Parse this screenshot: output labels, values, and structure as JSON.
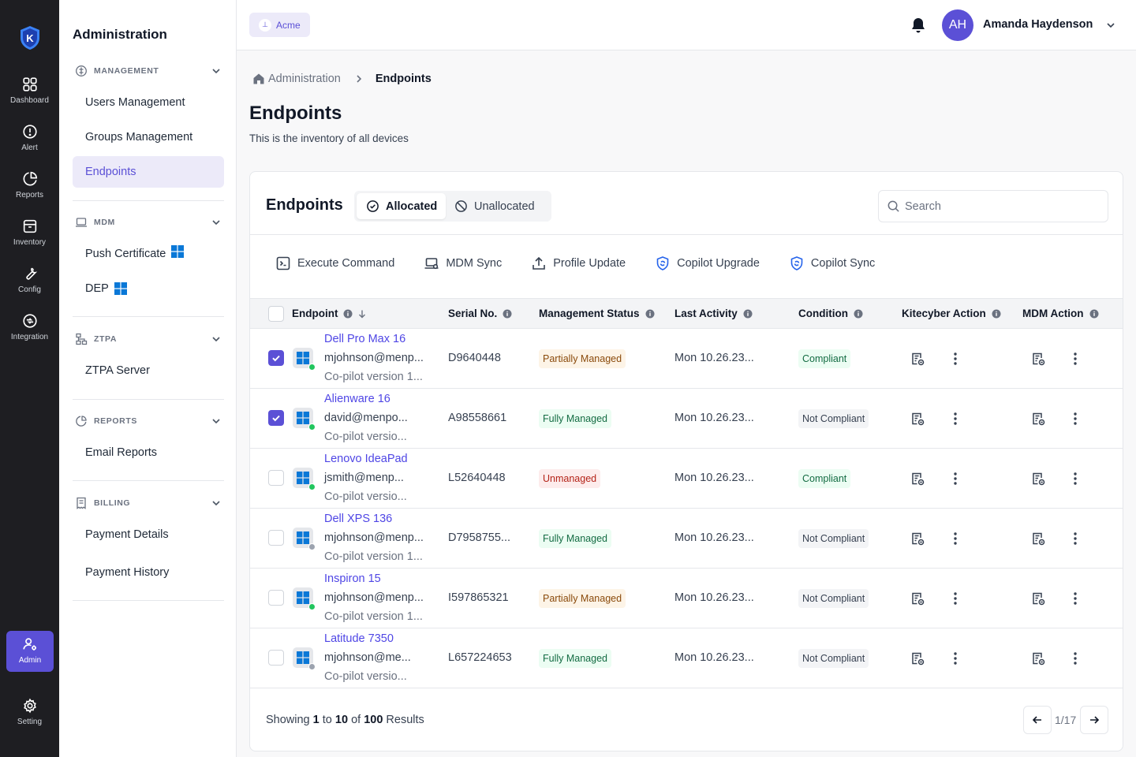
{
  "rail": {
    "items": [
      {
        "label": "Dashboard",
        "icon": "grid-icon"
      },
      {
        "label": "Alert",
        "icon": "alert-icon"
      },
      {
        "label": "Reports",
        "icon": "pie-chart-icon"
      },
      {
        "label": "Inventory",
        "icon": "archive-icon"
      },
      {
        "label": "Config",
        "icon": "wrench-icon"
      },
      {
        "label": "Integration",
        "icon": "integration-icon"
      }
    ],
    "admin": "Admin",
    "setting": "Setting"
  },
  "sidebar": {
    "title": "Administration",
    "sections": [
      {
        "name": "MANAGEMENT",
        "links": [
          "Users Management",
          "Groups Management",
          "Endpoints"
        ]
      },
      {
        "name": "MDM",
        "links": [
          "Push Certificate",
          "DEP"
        ]
      },
      {
        "name": "ZTPA",
        "links": [
          "ZTPA Server"
        ]
      },
      {
        "name": "REPORTS",
        "links": [
          "Email Reports"
        ]
      },
      {
        "name": "BILLING",
        "links": [
          "Payment Details",
          "Payment History"
        ]
      }
    ],
    "active": "Endpoints"
  },
  "header": {
    "org": "Acme",
    "user_initials": "AH",
    "user_name": "Amanda Haydenson"
  },
  "breadcrumb": {
    "parent": "Administration",
    "current": "Endpoints"
  },
  "page": {
    "title": "Endpoints",
    "subtitle": "This is the inventory of all devices"
  },
  "card": {
    "title": "Endpoints",
    "tabs": {
      "allocated": "Allocated",
      "unallocated": "Unallocated"
    },
    "search_placeholder": "Search",
    "actions": [
      "Execute Command",
      "MDM Sync",
      "Profile Update",
      "Copilot Upgrade",
      "Copilot Sync"
    ],
    "accent": "#5b50d6"
  },
  "table": {
    "columns": [
      "Endpoint",
      "Serial No.",
      "Management Status",
      "Last Activity",
      "Condition",
      "Kitecyber Action",
      "MDM Action"
    ],
    "rows": [
      {
        "name": "Dell Pro Max 16",
        "user": "mjohnson@menp...",
        "version": "Co-pilot version 1...",
        "serial": "D9640448",
        "mgmt": "Partially Managed",
        "last": "Mon 10.26.23...",
        "condition": "Compliant",
        "checked": true,
        "online": true
      },
      {
        "name": "Alienware 16",
        "user": "david@menpo...",
        "version": "Co-pilot versio...",
        "serial": "A98558661",
        "mgmt": "Fully Managed",
        "last": "Mon 10.26.23...",
        "condition": "Not Compliant",
        "checked": true,
        "online": true
      },
      {
        "name": "Lenovo IdeaPad",
        "user": "jsmith@menp...",
        "version": "Co-pilot versio...",
        "serial": "L52640448",
        "mgmt": "Unmanaged",
        "last": "Mon 10.26.23...",
        "condition": "Compliant",
        "checked": false,
        "online": true
      },
      {
        "name": "Dell XPS 136",
        "user": "mjohnson@menp...",
        "version": "Co-pilot version 1...",
        "serial": "D7958755...",
        "mgmt": "Fully Managed",
        "last": "Mon 10.26.23...",
        "condition": "Not Compliant",
        "checked": false,
        "online": false
      },
      {
        "name": "Inspiron 15",
        "user": "mjohnson@menp...",
        "version": "Co-pilot version 1...",
        "serial": "I597865321",
        "mgmt": "Partially Managed",
        "last": "Mon 10.26.23...",
        "condition": "Not Compliant",
        "checked": false,
        "online": true
      },
      {
        "name": "Latitude 7350",
        "user": "mjohnson@me...",
        "version": "Co-pilot versio...",
        "serial": "L657224653",
        "mgmt": "Fully Managed",
        "last": "Mon 10.26.23...",
        "condition": "Not Compliant",
        "checked": false,
        "online": false
      }
    ]
  },
  "footer": {
    "showing": "Showing",
    "from": "1",
    "to_word": "to",
    "to": "10",
    "of_word": "of",
    "total": "100",
    "results": "Results",
    "page": "1/17"
  }
}
